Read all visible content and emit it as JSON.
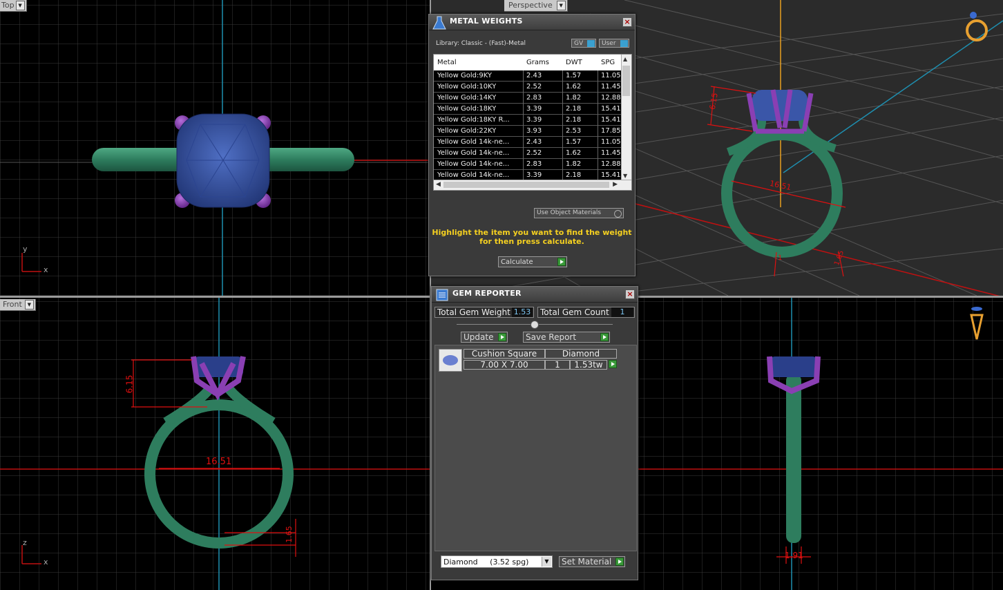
{
  "viewports": {
    "top": {
      "label": "Top",
      "axis_x": "x",
      "axis_y": "y"
    },
    "perspective": {
      "label": "Perspective"
    },
    "front": {
      "label": "Front",
      "axis_x": "x",
      "axis_y": "z"
    },
    "right": {
      "label": ""
    }
  },
  "dimensions": {
    "perspective_height": "6.15",
    "perspective_width": "16.51",
    "perspective_shank_left": "1",
    "perspective_shank_right": "1.65",
    "front_height": "6.15",
    "front_width": "16.51",
    "front_shank": "1.65",
    "side_shank": "1.91"
  },
  "metal_weights": {
    "title": "METAL WEIGHTS",
    "library": "Library: Classic - (Fast)-Metal",
    "gv_label": "GV",
    "user_label": "User",
    "columns": [
      "Metal",
      "Grams",
      "DWT",
      "SPG"
    ],
    "rows": [
      {
        "metal": "Yellow Gold:9KY",
        "grams": "2.43",
        "dwt": "1.57",
        "spg": "11.05"
      },
      {
        "metal": "Yellow Gold:10KY",
        "grams": "2.52",
        "dwt": "1.62",
        "spg": "11.45"
      },
      {
        "metal": "Yellow Gold:14KY",
        "grams": "2.83",
        "dwt": "1.82",
        "spg": "12.88"
      },
      {
        "metal": "Yellow Gold:18KY",
        "grams": "3.39",
        "dwt": "2.18",
        "spg": "15.41"
      },
      {
        "metal": "Yellow Gold:18KY R...",
        "grams": "3.39",
        "dwt": "2.18",
        "spg": "15.41"
      },
      {
        "metal": "Yellow Gold:22KY",
        "grams": "3.93",
        "dwt": "2.53",
        "spg": "17.85"
      },
      {
        "metal": "Yellow Gold 14k-ne...",
        "grams": "2.43",
        "dwt": "1.57",
        "spg": "11.05"
      },
      {
        "metal": "Yellow Gold 14k-ne...",
        "grams": "2.52",
        "dwt": "1.62",
        "spg": "11.45"
      },
      {
        "metal": "Yellow Gold 14k-ne...",
        "grams": "2.83",
        "dwt": "1.82",
        "spg": "12.88"
      },
      {
        "metal": "Yellow Gold 14k-ne...",
        "grams": "3.39",
        "dwt": "2.18",
        "spg": "15.41"
      },
      {
        "metal": "Yellow Gold 14k-ne...",
        "grams": "3.39",
        "dwt": "2.18",
        "spg": "15.41"
      }
    ],
    "use_object_materials": "Use Object Materials",
    "hint_line1": "Highlight the item you want to find the weight",
    "hint_line2": "for then press calculate.",
    "calculate_label": "Calculate"
  },
  "gem_reporter": {
    "title": "GEM REPORTER",
    "total_weight_label": "Total Gem Weight",
    "total_weight_value": "1.53",
    "total_count_label": "Total Gem Count",
    "total_count_value": "1",
    "update_label": "Update",
    "save_report_label": "Save Report",
    "gems": [
      {
        "shape": "Cushion Square",
        "size": "7.00 X 7.00",
        "material": "Diamond",
        "count": "1",
        "weight": "1.53tw"
      }
    ],
    "material_select": "Diamond     (3.52 spg)",
    "set_material_label": "Set Material"
  },
  "colors": {
    "metal": "#2e7d5e",
    "prong": "#8a3fb3",
    "gem": "#3a56a8",
    "dimension": "#e01010",
    "grid": "#3a3a3a",
    "hint": "#f5d020"
  }
}
